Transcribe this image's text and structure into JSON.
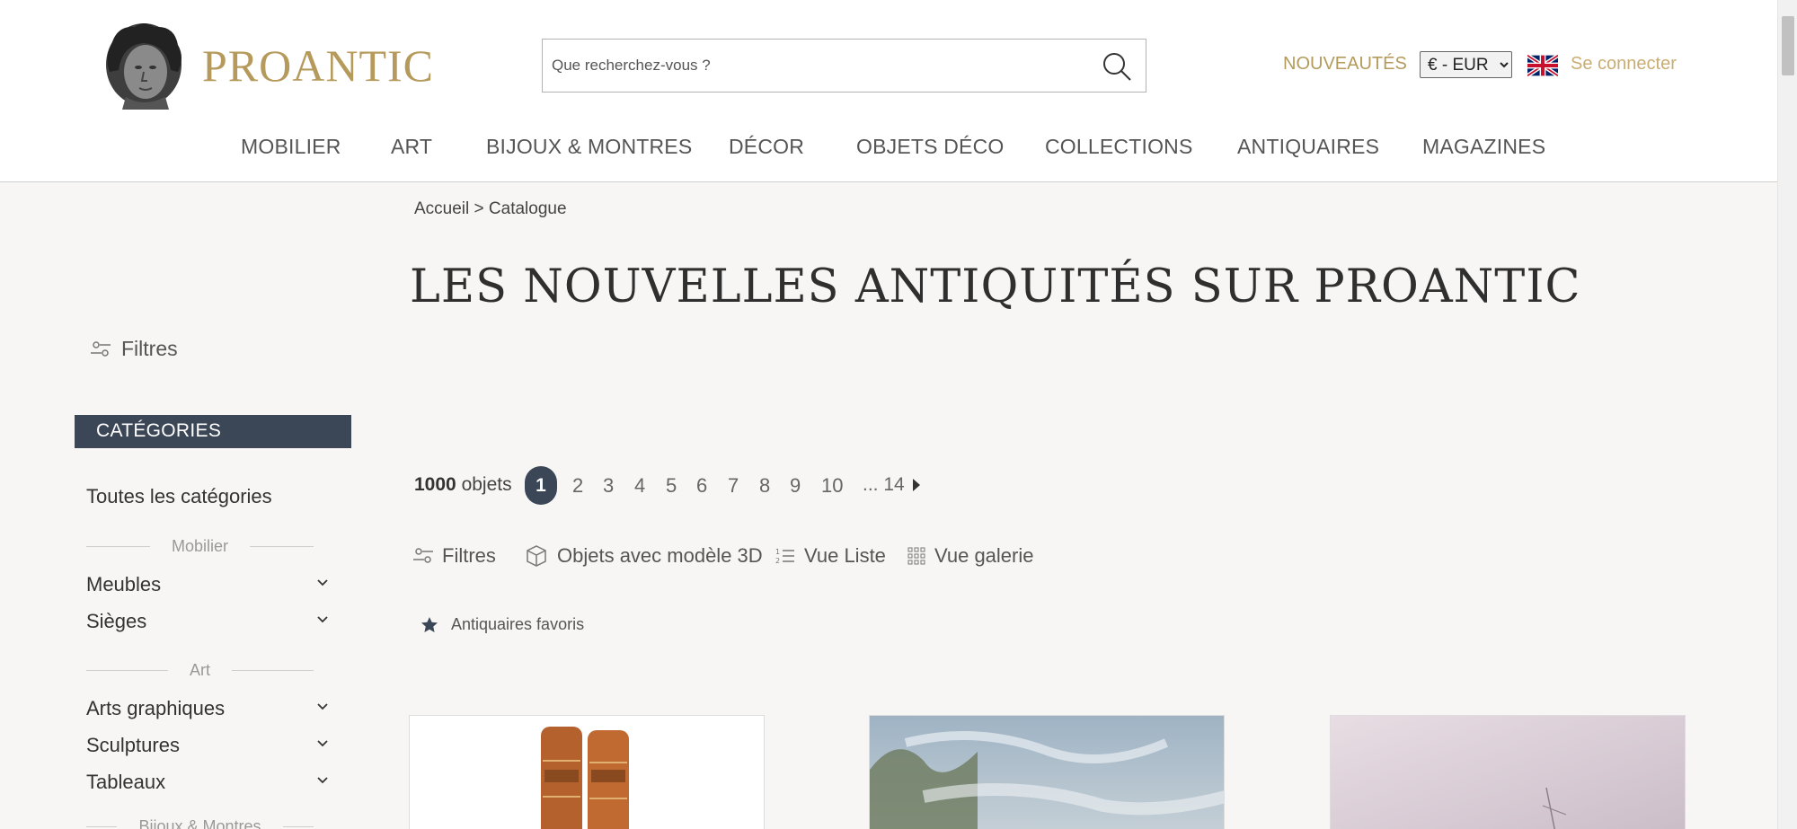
{
  "header": {
    "logo_text": "PROANTIC",
    "search_placeholder": "Que recherchez-vous ?",
    "nouveautes": "NOUVEAUTÉS",
    "currency": "€ - EUR",
    "login": "Se connecter"
  },
  "nav": [
    "MOBILIER",
    "ART",
    "BIJOUX & MONTRES",
    "DÉCOR",
    "OBJETS DÉCO",
    "COLLECTIONS",
    "ANTIQUAIRES",
    "MAGAZINES"
  ],
  "breadcrumb": "Accueil > Catalogue",
  "page_title": "LES NOUVELLES ANTIQUITÉS SUR PROANTIC",
  "sidebar": {
    "filters": "Filtres",
    "categories_title": "CATÉGORIES",
    "all_categories": "Toutes les catégories",
    "sections": [
      {
        "label": "Mobilier",
        "items": [
          "Meubles",
          "Sièges"
        ]
      },
      {
        "label": "Art",
        "items": [
          "Arts graphiques",
          "Sculptures",
          "Tableaux"
        ]
      },
      {
        "label": "Bijoux & Montres",
        "items": []
      }
    ]
  },
  "results": {
    "count": "1000",
    "count_label": "objets",
    "pages": [
      "1",
      "2",
      "3",
      "4",
      "5",
      "6",
      "7",
      "8",
      "9",
      "10",
      "... 14"
    ],
    "current_page": "1"
  },
  "toolbar": {
    "filters": "Filtres",
    "models_3d": "Objets avec modèle 3D",
    "list_view": "Vue Liste",
    "gallery_view": "Vue galerie"
  },
  "favorites": "Antiquaires favoris",
  "colors": {
    "brand_gold": "#b59a5c",
    "dark_slate": "#3b4656",
    "background": "#f7f6f4"
  }
}
